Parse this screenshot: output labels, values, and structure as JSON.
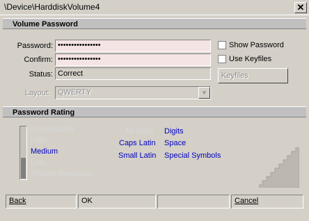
{
  "window": {
    "title": "\\Device\\HarddiskVolume4",
    "close_glyph": "✕"
  },
  "volume_password": {
    "header": "Volume Password",
    "password_label": "Password:",
    "password_value": "••••••••••••••••",
    "confirm_label": "Confirm:",
    "confirm_value": "••••••••••••••••",
    "status_label": "Status:",
    "status_value": "Correct",
    "layout_label": "Layout:",
    "layout_value": "QWERTY",
    "show_password_label": "Show Password",
    "show_password_checked": false,
    "use_keyfiles_label": "Use Keyfiles",
    "use_keyfiles_checked": false,
    "keyfiles_button": "Keyfiles"
  },
  "password_rating": {
    "header": "Password Rating",
    "levels": [
      "Unbreakable",
      "High",
      "Medium",
      "Low",
      "Trivially Breakable"
    ],
    "current_level": "Medium",
    "char_classes": [
      {
        "label": "All Other",
        "active": false
      },
      {
        "label": "Caps Latin",
        "active": true
      },
      {
        "label": "Small Latin",
        "active": true
      },
      {
        "label": "Digits",
        "active": true
      },
      {
        "label": "Space",
        "active": true
      },
      {
        "label": "Special Symbols",
        "active": true
      }
    ]
  },
  "buttons": {
    "back": "Back",
    "ok": "OK",
    "cancel": "Cancel"
  }
}
